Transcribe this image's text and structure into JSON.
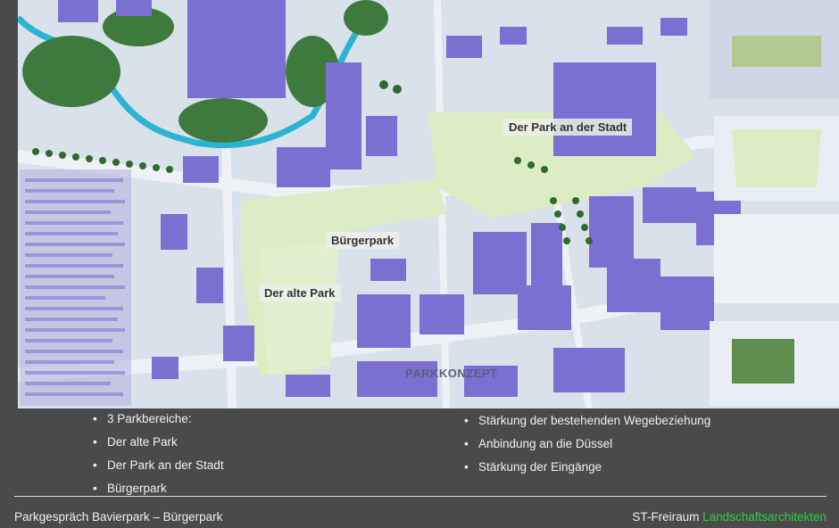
{
  "map": {
    "labels": {
      "park_stadt": "Der Park an der Stadt",
      "buergerpark": "Bürgerpark",
      "alte_park": "Der alte Park"
    },
    "plan_title": "PARKKONZEPT",
    "colors": {
      "building": "#7b6fd1",
      "park": "#dcecc4",
      "water": "#2ab4d2",
      "trees": "#3e7a3e",
      "road": "#eef2f6"
    }
  },
  "bullets_left": [
    "3 Parkbereiche:",
    "Der alte Park",
    "Der Park an der Stadt",
    "Bürgerpark"
  ],
  "bullets_right": [
    "Stärkung der bestehenden Wegebeziehung",
    "Anbindung an die Düssel",
    "Stärkung der Eingänge"
  ],
  "footer": {
    "left": "Parkgespräch Bavierpark – Bürgerpark",
    "right_prefix": "ST-Freiraum ",
    "right_accent": "Landschaftsarchitekten"
  }
}
